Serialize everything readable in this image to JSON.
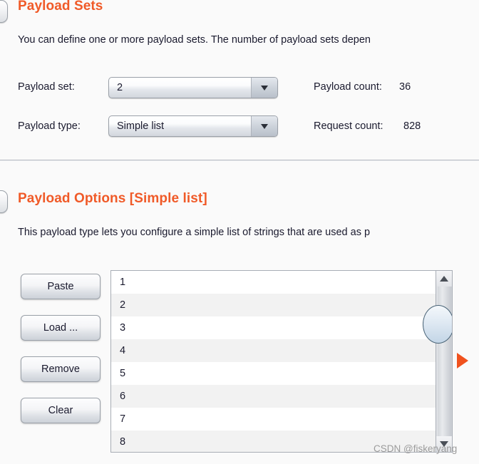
{
  "app": {
    "accent_color": "#f05a28",
    "background_color": "#fafafa",
    "text_color": "#1a1a2e"
  },
  "payload_sets": {
    "heading": "Payload Sets",
    "description": "You can define one or more payload sets. The number of payload sets depen",
    "payload_set": {
      "label": "Payload set:",
      "value": "2",
      "arrow_icon": "chevron-down-icon"
    },
    "payload_type": {
      "label": "Payload type:",
      "value": "Simple list",
      "arrow_icon": "chevron-down-icon"
    },
    "payload_count": {
      "label": "Payload count:",
      "value": "36"
    },
    "request_count": {
      "label": "Request count:",
      "value": "828"
    }
  },
  "payload_options": {
    "heading": "Payload Options [Simple list]",
    "description": "This payload type lets you configure a simple list of strings that are used as p",
    "buttons": [
      {
        "id": "paste",
        "label": "Paste"
      },
      {
        "id": "load",
        "label": "Load ..."
      },
      {
        "id": "remove",
        "label": "Remove"
      },
      {
        "id": "clear",
        "label": "Clear"
      }
    ],
    "list_rows": [
      {
        "value": "1"
      },
      {
        "value": "2"
      },
      {
        "value": "3"
      },
      {
        "value": "4"
      },
      {
        "value": "5"
      },
      {
        "value": "6"
      },
      {
        "value": "7"
      },
      {
        "value": "8"
      }
    ],
    "scrollbar": {
      "up_arrow_icon": "triangle-up-icon",
      "down_arrow_icon": "triangle-down-icon",
      "thumb_icon": "scrollbar-thumb"
    }
  },
  "pointer": {
    "icon": "triangle-right-icon",
    "color": "#f0521e"
  },
  "watermark": {
    "text": "CSDN @fiskeryang"
  }
}
